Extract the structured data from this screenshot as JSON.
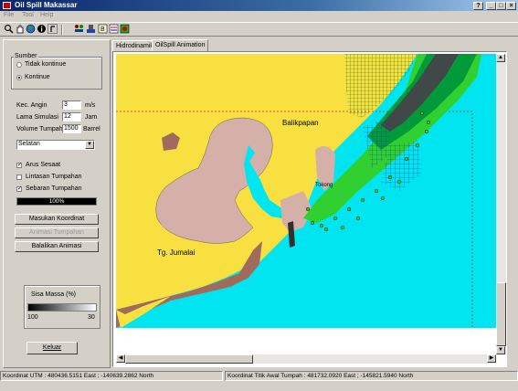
{
  "window": {
    "title": "Oil Spill Makassar",
    "controls": [
      "?",
      "_",
      "□",
      "×"
    ]
  },
  "menu": [
    "File",
    "Tool",
    "Help"
  ],
  "toolbar": {
    "icons": [
      "zoom-icon",
      "pan-icon",
      "globe-icon",
      "info-icon",
      "pointer-icon",
      "tool-icon-1",
      "tool-icon-2",
      "tool-icon-3",
      "tool-icon-4",
      "tool-icon-5"
    ]
  },
  "panel": {
    "sumber": {
      "label": "Sumber",
      "options": [
        {
          "label": "Tidak kontinue",
          "selected": false
        },
        {
          "label": "Kontinue",
          "selected": true
        }
      ]
    },
    "fields": [
      {
        "label": "Kec. Angin",
        "value": "3",
        "unit": "m/s"
      },
      {
        "label": "Lama Simulasi",
        "value": "12",
        "unit": "Jam"
      },
      {
        "label": "Volume Tumpah",
        "value": "1500",
        "unit": "Barrel"
      }
    ],
    "direction_select": "Selatan",
    "checks": [
      {
        "label": "Arus Sesaat",
        "checked": true
      },
      {
        "label": "Lintasan Tumpahan",
        "checked": false
      },
      {
        "label": "Sebaran Tumpahan",
        "checked": true
      }
    ],
    "progress": {
      "text": "100%",
      "value": 1.0
    },
    "buttons": [
      {
        "label": "Masukan Koordinat",
        "enabled": true
      },
      {
        "label": "Animasi Tumpahan",
        "enabled": false
      },
      {
        "label": "Balalikan Animasi",
        "enabled": true
      }
    ],
    "legend": {
      "label": "Sisa Massa (%)",
      "min_label": "100",
      "max_label": "30"
    },
    "exit_button": "Keluar"
  },
  "tabs": [
    {
      "label": "Hidrodinamika",
      "active": false
    },
    {
      "label": "OilSpill Animation",
      "active": true
    }
  ],
  "map": {
    "labels": {
      "city": "Balikpapan",
      "cape": "Tg. Jumalai",
      "area": "Tokong"
    },
    "colors": {
      "sea": "#00e5f0",
      "land": "#f8e040",
      "land_pink": "#d4b0a8",
      "land_brown": "#a06a5c",
      "spill_light": "#30d030",
      "spill_mid": "#009a3a",
      "spill_dark": "#404848"
    }
  },
  "status": {
    "utm": "Koordinat UTM : 480436.5151 East ; -140639.2862 North",
    "spill_origin": "Koordinat Titik Awal Tumpah : 481732.0920 East ; -145821.5940 North"
  }
}
